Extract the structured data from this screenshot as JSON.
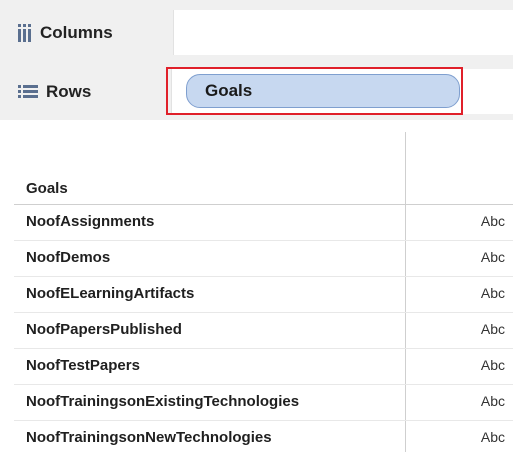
{
  "shelves": {
    "columns_label": "Columns",
    "rows_label": "Rows",
    "rows_pill": "Goals"
  },
  "table": {
    "header": "Goals",
    "rows": [
      {
        "label": "NoofAssignments",
        "value": "Abc"
      },
      {
        "label": "NoofDemos",
        "value": "Abc"
      },
      {
        "label": "NoofELearningArtifacts",
        "value": "Abc"
      },
      {
        "label": "NoofPapersPublished",
        "value": "Abc"
      },
      {
        "label": "NoofTestPapers",
        "value": "Abc"
      },
      {
        "label": "NoofTrainingsonExistingTechnologies",
        "value": "Abc"
      },
      {
        "label": "NoofTrainingsonNewTechnologies",
        "value": "Abc"
      }
    ]
  },
  "colors": {
    "pill_fill": "#c7d8f0",
    "highlight": "#e0202a"
  },
  "icons": {
    "columns": "columns-icon",
    "rows": "rows-icon"
  }
}
